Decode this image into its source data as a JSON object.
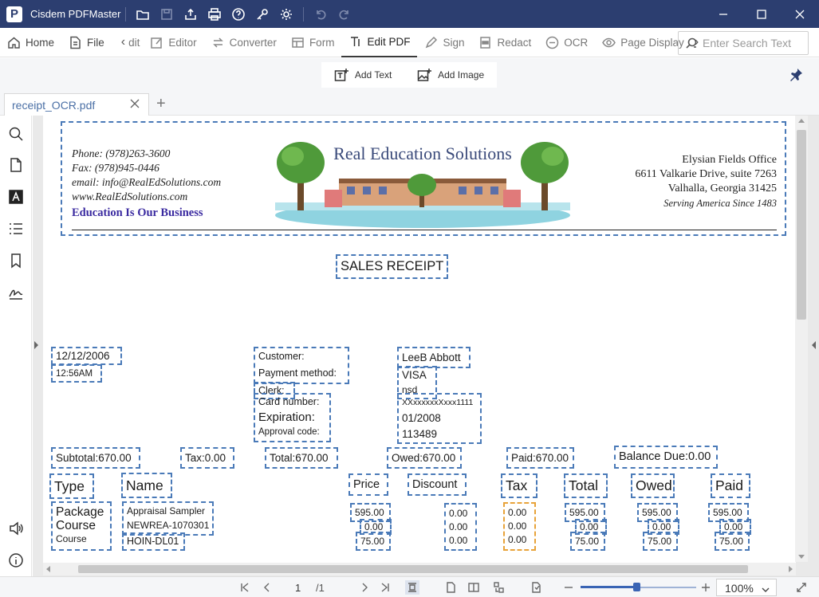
{
  "app": {
    "title": "Cisdem PDFMaster",
    "logo_letter": "P"
  },
  "menu": {
    "home": "Home",
    "file": "File",
    "edit_clip": "dit",
    "editor": "Editor",
    "converter": "Converter",
    "form": "Form",
    "edit_pdf": "Edit PDF",
    "sign": "Sign",
    "redact": "Redact",
    "ocr": "OCR",
    "page_display": "Page Display"
  },
  "search": {
    "placeholder": "Enter Search Text"
  },
  "subtoolbar": {
    "add_text": "Add Text",
    "add_image": "Add Image"
  },
  "tab": {
    "label": "receipt_OCR.pdf"
  },
  "receipt": {
    "header_left": {
      "phone": "Phone: (978)263-3600",
      "fax": "Fax: (978)945-0446",
      "email": "email: info@RealEdSolutions.com",
      "web": "www.RealEdSolutions.com",
      "slogan": "Education Is Our Business"
    },
    "header_center": "Real Education Solutions",
    "header_right": {
      "office": "Elysian Fields Office",
      "street": "6611 Valkarie Drive, suite 7263",
      "city": "Valhalla, Georgia 31425",
      "tagline": "Serving America Since 1483"
    },
    "title": "SALES RECEIPT",
    "date": "12/12/2006",
    "time": "12:56AM",
    "labels": {
      "customer": "Customer:",
      "payment_method": "Payment method:",
      "clerk": "Clerk:",
      "card_number": "Card number:",
      "expiration": "Expiration:",
      "approval_code": "Approval code:"
    },
    "values": {
      "customer": "LeeB Abbott",
      "payment_method": "VISA",
      "clerk": "nsd",
      "card_number": "XXxxxxxxXxxx1111",
      "expiration": "01/2008",
      "approval_code": "113489"
    },
    "totals": {
      "subtotal": "Subtotal:670.00",
      "tax": "Tax:0.00",
      "total": "Total:670.00",
      "owed": "Owed:670.00",
      "paid": "Paid:670.00",
      "balance": "Balance Due:0.00"
    },
    "columns": {
      "type": "Type",
      "name": "Name",
      "price": "Price",
      "discount": "Discount",
      "tax": "Tax",
      "total": "Total",
      "owed": "Owed",
      "paid": "Paid"
    },
    "item": {
      "type_line1": "Package",
      "type_line2": "Course",
      "type_line3": "Course",
      "name_line1": "Appraisal Sampler",
      "name_line2": "NEWREA-1070301",
      "name_line3": "HOIN-DL01",
      "price": [
        "595.00",
        "0.00",
        "75.00"
      ],
      "discount": [
        "0.00",
        "0.00",
        "0.00"
      ],
      "tax": [
        "0.00",
        "0.00",
        "0.00"
      ],
      "total": [
        "595.00",
        "0.00",
        "75.00"
      ],
      "owed": [
        "595.00",
        "0.00",
        "75.00"
      ],
      "paid": [
        "595.00",
        "0.00",
        "75.00"
      ]
    }
  },
  "statusbar": {
    "page": "1",
    "total": "/1",
    "zoom": "100%"
  }
}
